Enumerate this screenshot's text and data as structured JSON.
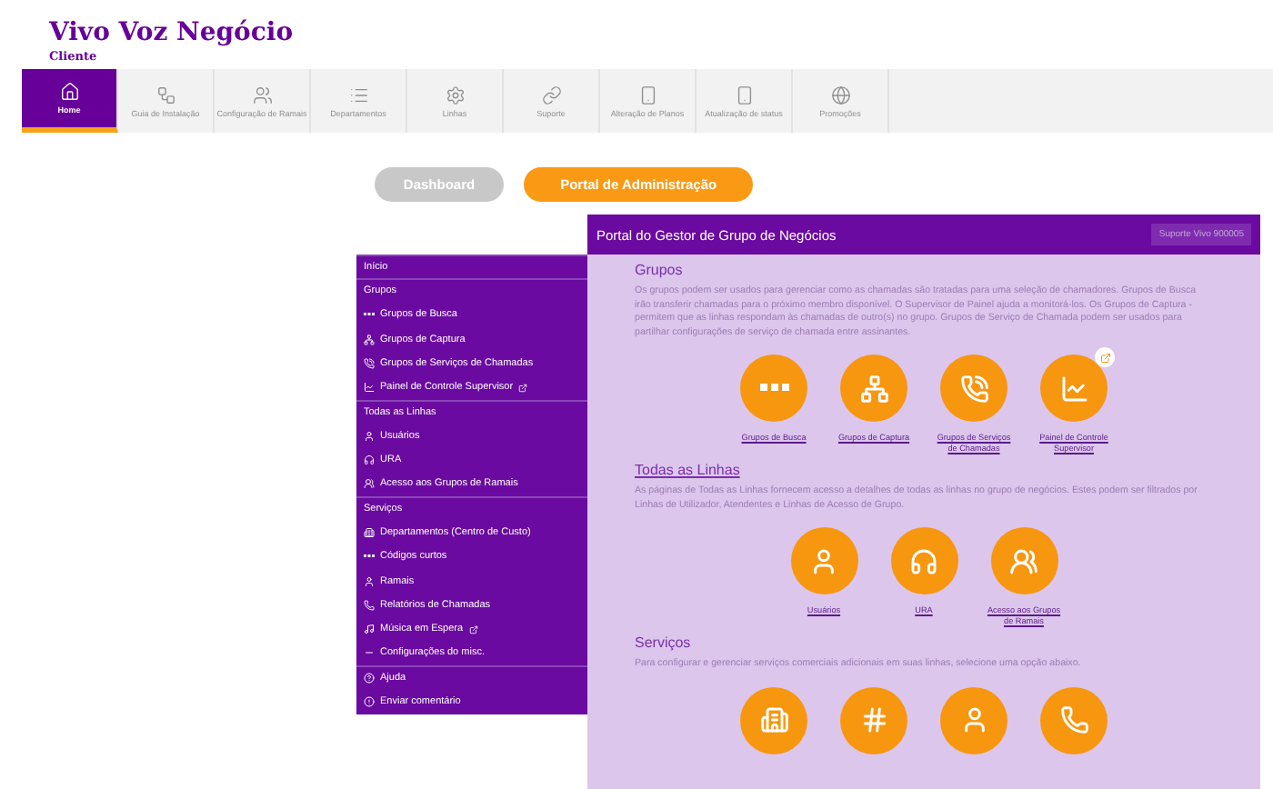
{
  "brand": {
    "title": "Vivo Voz Negócio",
    "subtitle": "Cliente"
  },
  "nav": [
    {
      "label": "Home",
      "selected": true
    },
    {
      "label": "Guia de Instalação",
      "selected": false
    },
    {
      "label": "Configuração de Ramais",
      "selected": false
    },
    {
      "label": "Departamentos",
      "selected": false
    },
    {
      "label": "Linhas",
      "selected": false
    },
    {
      "label": "Suporte",
      "selected": false
    },
    {
      "label": "Alteração de Planos",
      "selected": false
    },
    {
      "label": "Atualização de status",
      "selected": false
    },
    {
      "label": "Promoções",
      "selected": false
    }
  ],
  "switch": [
    {
      "label": "Dashboard",
      "selected": false
    },
    {
      "label": "Portal de Administração",
      "selected": true
    }
  ],
  "menu": [
    {
      "kind": "header",
      "label": "Início",
      "external": false
    },
    {
      "kind": "header",
      "label": "Grupos",
      "external": false
    },
    {
      "kind": "item",
      "label": "Grupos de Busca",
      "external": false
    },
    {
      "kind": "item",
      "label": "Grupos de Captura",
      "external": false
    },
    {
      "kind": "item",
      "label": "Grupos de Serviços de Chamadas",
      "external": false
    },
    {
      "kind": "item",
      "label": "Painel de Controle Supervisor",
      "external": true
    },
    {
      "kind": "header",
      "label": "Todas as Linhas",
      "external": false
    },
    {
      "kind": "item",
      "label": "Usuários",
      "external": false
    },
    {
      "kind": "item",
      "label": "URA",
      "external": false
    },
    {
      "kind": "item",
      "label": "Acesso aos Grupos de Ramais",
      "external": false
    },
    {
      "kind": "header",
      "label": "Serviços",
      "external": false
    },
    {
      "kind": "item",
      "label": "Departamentos (Centro de Custo)",
      "external": false
    },
    {
      "kind": "item",
      "label": "Códigos curtos",
      "external": false
    },
    {
      "kind": "item",
      "label": "Ramais",
      "external": false
    },
    {
      "kind": "item",
      "label": "Relatórios de Chamadas",
      "external": false
    },
    {
      "kind": "item",
      "label": "Música em Espera",
      "external": true
    },
    {
      "kind": "item",
      "label": "Configurações do misc.",
      "external": false
    },
    {
      "kind": "separated",
      "label": "Ajuda",
      "external": false
    },
    {
      "kind": "item",
      "label": "Enviar comentário",
      "external": false
    }
  ],
  "portal": {
    "title": "Portal do Gestor de Grupo de Negócios",
    "support": "Suporte Vivo 900005",
    "sections": [
      {
        "title": "Grupos",
        "underlined": false,
        "text": "Os grupos podem ser usados para gerenciar como as chamadas são tratadas para uma seleção de chamadores. Grupos de Busca irão transferir chamadas para o próximo membro disponível. O Supervisor de Painel ajuda a monitorá-los. Os Grupos de Captura - permitem que as linhas respondam às chamadas de outro(s) no grupo. Grupos de Serviço de Chamada podem ser usados para partilhar configurações de serviço de chamada entre assinantes.",
        "tiles": [
          {
            "label": "Grupos de Busca",
            "external": false
          },
          {
            "label": "Grupos de Captura",
            "external": false
          },
          {
            "label": "Grupos de Serviços de Chamadas",
            "external": false
          },
          {
            "label": "Painel de Controle Supervisor",
            "external": true
          }
        ]
      },
      {
        "title": "Todas as Linhas",
        "underlined": true,
        "text": "As páginas de Todas as Linhas fornecem acesso a detalhes de todas as linhas no grupo de negócios. Estes podem ser filtrados por Linhas de Utilizador, Atendentes e Linhas de Acesso de Grupo.",
        "tiles": [
          {
            "label": "Usuários",
            "external": false
          },
          {
            "label": "URA",
            "external": false
          },
          {
            "label": "Acesso aos Grupos de Ramais",
            "external": false
          }
        ]
      },
      {
        "title": "Serviços",
        "underlined": false,
        "text": "Para configurar e gerenciar serviços comerciais adicionais em suas linhas, selecione uma opção abaixo.",
        "tiles": [
          {
            "external": false
          },
          {
            "external": false
          },
          {
            "external": false
          },
          {
            "external": false
          }
        ]
      }
    ]
  }
}
